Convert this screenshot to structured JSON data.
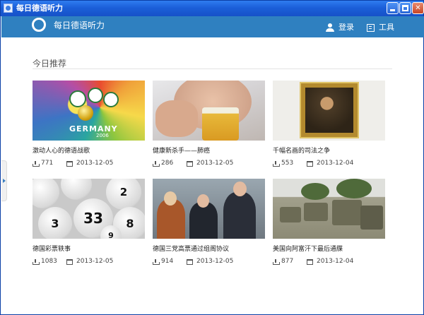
{
  "window": {
    "title": "每日德语听力"
  },
  "header": {
    "brand": "每日德语听力",
    "login_label": "登录",
    "tools_label": "工具"
  },
  "section": {
    "title": "今日推荐"
  },
  "cards": [
    {
      "title": "激动人心的德语战歌",
      "downloads": "771",
      "date": "2013-12-05",
      "thumb": "germany-2006-poster"
    },
    {
      "title": "健康新杀手——肺癌",
      "downloads": "286",
      "date": "2013-12-05",
      "thumb": "man-drinking-beer"
    },
    {
      "title": "千幅名画的司法之争",
      "downloads": "553",
      "date": "2013-12-04",
      "thumb": "framed-painting"
    },
    {
      "title": "德国彩票轶事",
      "downloads": "1083",
      "date": "2013-12-05",
      "thumb": "lottery-balls"
    },
    {
      "title": "德国三党高票通过组阁协议",
      "downloads": "914",
      "date": "2013-12-05",
      "thumb": "politicians"
    },
    {
      "title": "美国向阿富汗下最后通牒",
      "downloads": "877",
      "date": "2013-12-04",
      "thumb": "military-vehicles"
    }
  ],
  "poster": {
    "word": "GERMANY",
    "year": "2006"
  },
  "lotto_numbers": [
    "33",
    "3",
    "8",
    "9",
    "2"
  ],
  "colors": {
    "header": "#2f80c0",
    "titlebar": "#1b5fd9"
  }
}
